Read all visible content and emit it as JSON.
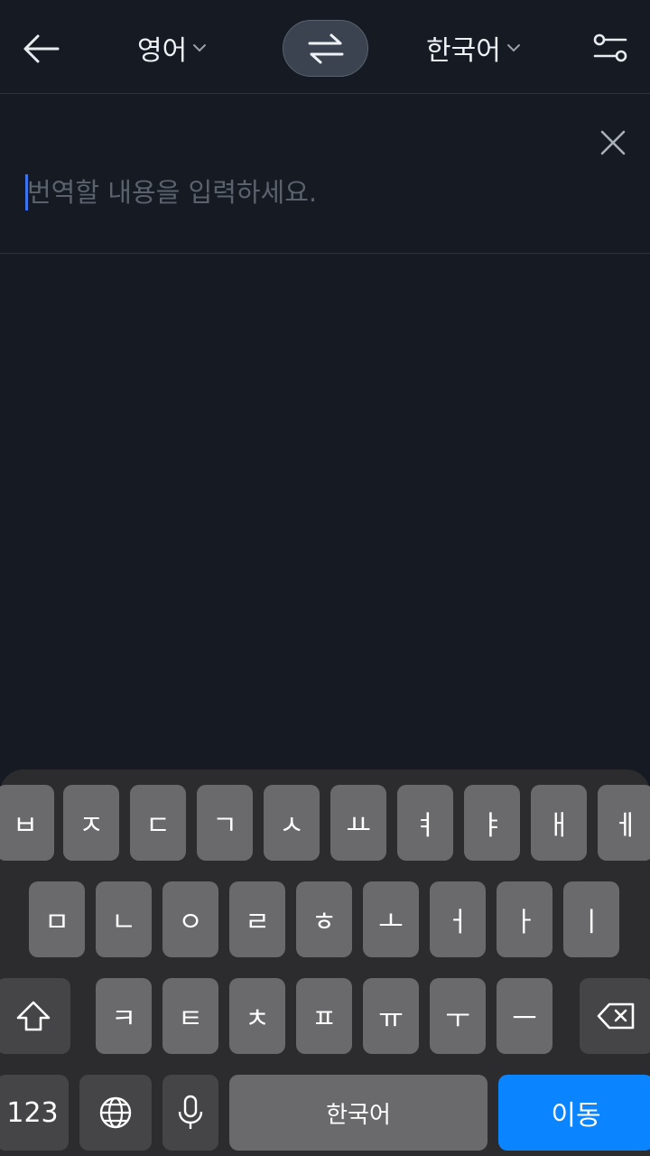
{
  "header": {
    "source_language": "영어",
    "target_language": "한국어"
  },
  "input": {
    "placeholder": "번역할 내용을 입력하세요."
  },
  "keyboard": {
    "row1": [
      "ㅂ",
      "ㅈ",
      "ㄷ",
      "ㄱ",
      "ㅅ",
      "ㅛ",
      "ㅕ",
      "ㅑ",
      "ㅐ",
      "ㅔ"
    ],
    "row2": [
      "ㅁ",
      "ㄴ",
      "ㅇ",
      "ㄹ",
      "ㅎ",
      "ㅗ",
      "ㅓ",
      "ㅏ",
      "ㅣ"
    ],
    "row3": [
      "ㅋ",
      "ㅌ",
      "ㅊ",
      "ㅍ",
      "ㅠ",
      "ㅜ",
      "ㅡ"
    ],
    "numbers_label": "123",
    "space_label": "한국어",
    "return_label": "이동"
  },
  "colors": {
    "background": "#161b23",
    "accent": "#0a84ff",
    "caret": "#3c73f0"
  },
  "icons": [
    "back-arrow-icon",
    "chevron-down-icon",
    "swap-arrows-icon",
    "settings-sliders-icon",
    "close-icon",
    "shift-icon",
    "backspace-icon",
    "globe-icon",
    "microphone-icon"
  ]
}
